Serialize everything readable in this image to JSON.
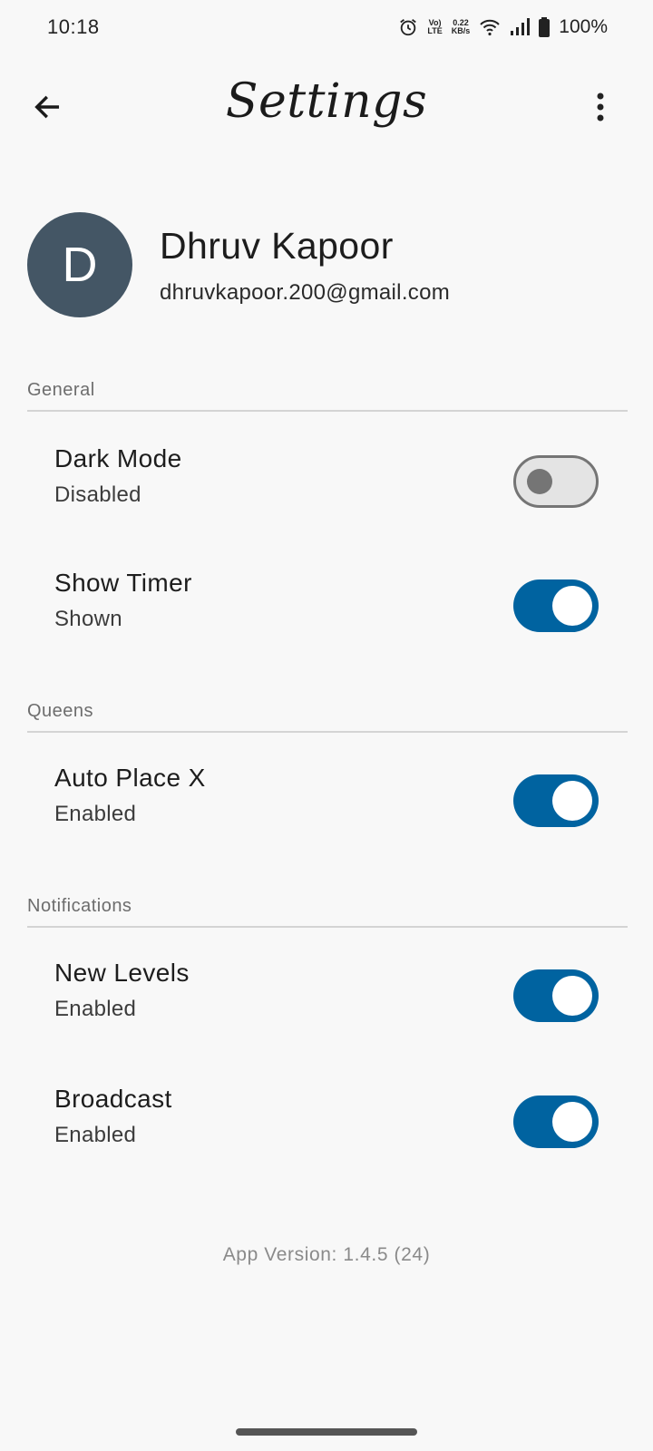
{
  "status_bar": {
    "time": "10:18",
    "net_speed_value": "0.22",
    "net_speed_unit": "KB/s",
    "volte_top": "Vo)",
    "volte_bottom": "LTE",
    "battery": "100%",
    "icons": [
      "alarm-icon",
      "volte-icon",
      "wifi-icon",
      "signal-icon",
      "battery-icon"
    ]
  },
  "app_bar": {
    "title": "Settings",
    "back_icon": "arrow-left-icon",
    "menu_icon": "more-vert-icon"
  },
  "profile": {
    "avatar_letter": "D",
    "name": "Dhruv Kapoor",
    "email": "dhruvkapoor.200@gmail.com",
    "avatar_color": "#445665"
  },
  "sections": {
    "general": {
      "header": "General",
      "dark_mode": {
        "title": "Dark Mode",
        "subtitle": "Disabled",
        "enabled": false
      },
      "show_timer": {
        "title": "Show Timer",
        "subtitle": "Shown",
        "enabled": true
      }
    },
    "queens": {
      "header": "Queens",
      "auto_place_x": {
        "title": "Auto Place X",
        "subtitle": "Enabled",
        "enabled": true
      }
    },
    "notifications": {
      "header": "Notifications",
      "new_levels": {
        "title": "New Levels",
        "subtitle": "Enabled",
        "enabled": true
      },
      "broadcast": {
        "title": "Broadcast",
        "subtitle": "Enabled",
        "enabled": true
      }
    }
  },
  "footer": {
    "version": "App Version: 1.4.5 (24)"
  },
  "colors": {
    "accent": "#0063a0",
    "background": "#f8f8f8",
    "switch_off_track": "#e4e4e4",
    "switch_off_outline": "#757575"
  }
}
